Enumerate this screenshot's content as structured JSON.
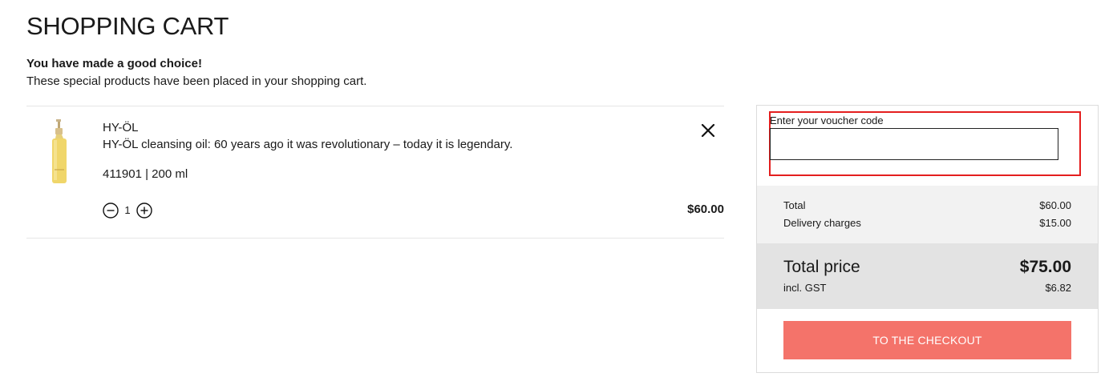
{
  "page": {
    "title": "SHOPPING CART",
    "intro_heading": "You have made a good choice!",
    "intro_text": "These special products have been placed in your shopping cart."
  },
  "cart": {
    "items": [
      {
        "name": "HY-ÖL",
        "description": "HY-ÖL cleansing oil: 60 years ago it was revolutionary – today it is legendary.",
        "sku_size": "411901 | 200 ml",
        "quantity": "1",
        "price": "$60.00",
        "image_icon": "product-bottle-image",
        "remove_icon": "close-icon",
        "decrement_icon": "minus-circle-icon",
        "increment_icon": "plus-circle-icon"
      }
    ]
  },
  "summary": {
    "voucher_label": "Enter your voucher code",
    "voucher_value": "",
    "total_label": "Total",
    "total_value": "$60.00",
    "delivery_label": "Delivery charges",
    "delivery_value": "$15.00",
    "grand_label": "Total price",
    "grand_value": "$75.00",
    "gst_label": "incl. GST",
    "gst_value": "$6.82",
    "checkout_label": "TO THE CHECKOUT"
  },
  "colors": {
    "checkout_button": "#f4736a",
    "voucher_highlight": "#e41e1e",
    "totals_bg": "#f2f2f2",
    "grand_bg": "#e3e3e3"
  }
}
